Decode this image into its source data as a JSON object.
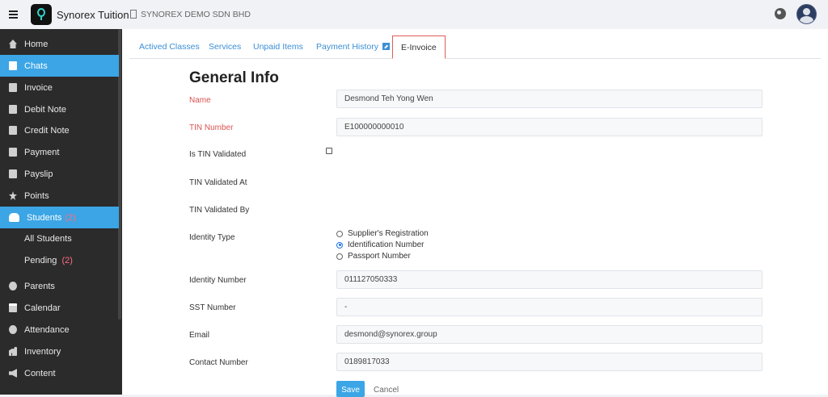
{
  "header": {
    "app_title": "Synorex Tuition",
    "company": "SYNOREX DEMO SDN BHD",
    "brand_color": "#31d4c9"
  },
  "sidebar": {
    "items": [
      {
        "label": "Home",
        "icon": "home-icon"
      },
      {
        "label": "Chats",
        "icon": "document-icon",
        "active": true
      },
      {
        "label": "Invoice",
        "icon": "document-icon"
      },
      {
        "label": "Debit Note",
        "icon": "document-icon"
      },
      {
        "label": "Credit Note",
        "icon": "document-icon"
      },
      {
        "label": "Payment",
        "icon": "document-icon"
      },
      {
        "label": "Payslip",
        "icon": "document-icon"
      },
      {
        "label": "Points",
        "icon": "star-icon"
      },
      {
        "label": "Students",
        "icon": "users-icon",
        "count": "(2)",
        "active": true
      },
      {
        "label": "Parents",
        "icon": "user-circle-icon"
      },
      {
        "label": "Calendar",
        "icon": "calendar-icon"
      },
      {
        "label": "Attendance",
        "icon": "clock-icon"
      },
      {
        "label": "Inventory",
        "icon": "boxes-icon"
      },
      {
        "label": "Content",
        "icon": "megaphone-icon"
      }
    ],
    "sub_items": [
      {
        "label": "All Students"
      },
      {
        "label": "Pending",
        "count": "(2)"
      }
    ]
  },
  "tabs": [
    {
      "label": "Actived Classes"
    },
    {
      "label": "Services"
    },
    {
      "label": "Unpaid Items"
    },
    {
      "label": "Payment History",
      "icon": "external-link-icon"
    },
    {
      "label": "E-Invoice",
      "selected": true
    }
  ],
  "form": {
    "title": "General Info",
    "name_label": "Name",
    "name_value": "Desmond Teh Yong Wen",
    "tin_label": "TIN Number",
    "tin_value": "E100000000010",
    "tin_validated_label": "Is TIN Validated",
    "tin_validated_at_label": "TIN Validated At",
    "tin_validated_by_label": "TIN Validated By",
    "identity_type_label": "Identity Type",
    "identity_options": [
      "Supplier's Registration",
      "Identification Number",
      "Passport Number"
    ],
    "identity_selected": "Identification Number",
    "identity_number_label": "Identity Number",
    "identity_number_value": "011127050333",
    "sst_label": "SST Number",
    "sst_value": "-",
    "email_label": "Email",
    "email_value": "desmond@synorex.group",
    "contact_label": "Contact Number",
    "contact_value": "0189817033",
    "save_label": "Save",
    "cancel_label": "Cancel"
  },
  "colors": {
    "accent": "#3ba5e6",
    "required": "#d9534f",
    "sidebar_bg": "#2b2b2b"
  }
}
